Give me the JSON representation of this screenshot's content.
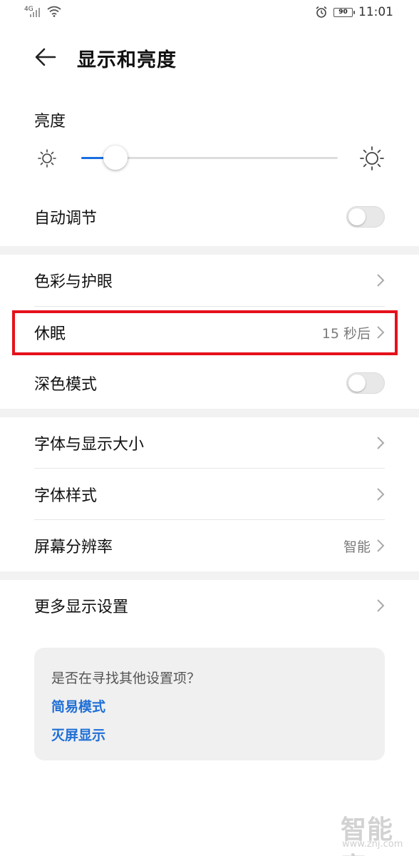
{
  "status_bar": {
    "network": "4G",
    "battery": "90",
    "time": "11:01",
    "icons": [
      "signal-icon",
      "wifi-icon",
      "alarm-icon",
      "battery-icon"
    ]
  },
  "header": {
    "title": "显示和亮度"
  },
  "brightness": {
    "label": "亮度",
    "level_fraction": 0.09,
    "accent": "#1a6fe0"
  },
  "auto_adjust": {
    "label": "自动调节",
    "enabled": false
  },
  "color_eye": {
    "label": "色彩与护眼"
  },
  "sleep": {
    "label": "休眠",
    "value": "15 秒后",
    "highlight_color": "#e5111c"
  },
  "dark_mode": {
    "label": "深色模式",
    "enabled": false
  },
  "font_display_size": {
    "label": "字体与显示大小"
  },
  "font_style": {
    "label": "字体样式"
  },
  "resolution": {
    "label": "屏幕分辨率",
    "value": "智能"
  },
  "more_display": {
    "label": "更多显示设置"
  },
  "suggestion_card": {
    "title": "是否在寻找其他设置项？",
    "links": [
      "简易模式",
      "灭屏显示"
    ],
    "link_color": "#1f6fd6"
  },
  "watermark": {
    "text": "智能家",
    "url": "www.znj.com"
  }
}
